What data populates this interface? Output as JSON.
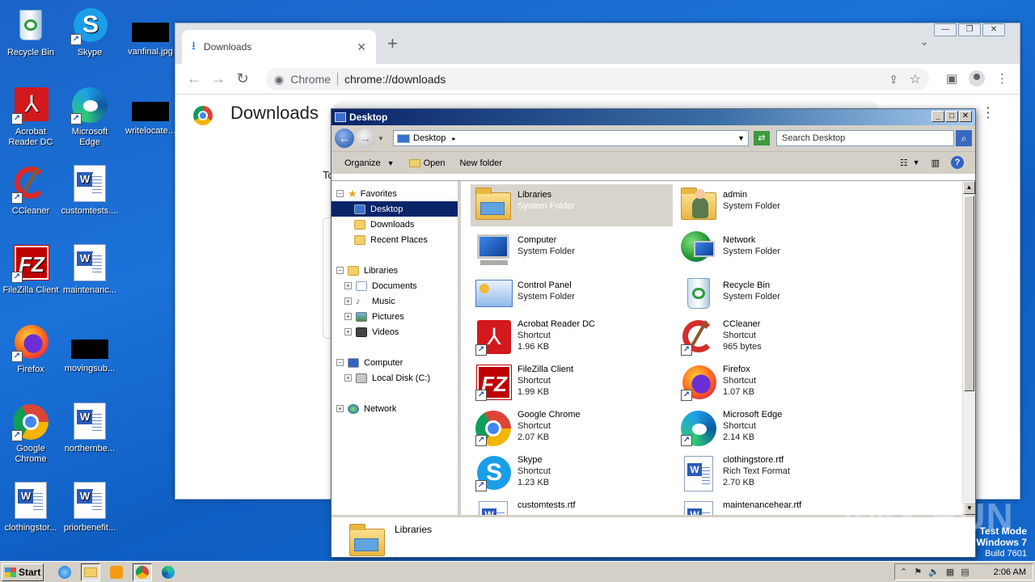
{
  "desktop": {
    "icons": [
      {
        "label": "Recycle Bin",
        "icon": "recycle-bin-icon"
      },
      {
        "label": "Skype",
        "icon": "skype-icon"
      },
      {
        "label": "vanfinal.jpg",
        "icon": "image-thumbnail-icon"
      },
      {
        "label": "Acrobat Reader DC",
        "icon": "acrobat-icon"
      },
      {
        "label": "Microsoft Edge",
        "icon": "edge-icon"
      },
      {
        "label": "writelocate...",
        "icon": "image-thumbnail-icon"
      },
      {
        "label": "CCleaner",
        "icon": "ccleaner-icon"
      },
      {
        "label": "customtests....",
        "icon": "word-doc-icon"
      },
      {
        "label": "FileZilla Client",
        "icon": "filezilla-icon"
      },
      {
        "label": "maintenanc...",
        "icon": "word-doc-icon"
      },
      {
        "label": "Firefox",
        "icon": "firefox-icon"
      },
      {
        "label": "movingsub...",
        "icon": "image-thumbnail-icon"
      },
      {
        "label": "Google Chrome",
        "icon": "chrome-icon"
      },
      {
        "label": "northernbe...",
        "icon": "word-doc-icon"
      },
      {
        "label": "clothingstor...",
        "icon": "word-doc-icon"
      },
      {
        "label": "priorbenefit...",
        "icon": "word-doc-icon"
      }
    ]
  },
  "chrome": {
    "tab_title": "Downloads",
    "omnibox_site": "Chrome",
    "omnibox_url": "chrome://downloads",
    "page_title": "Downloads",
    "today_label": "To"
  },
  "explorer": {
    "window_title": "Desktop",
    "address_path": "Desktop",
    "search_placeholder": "Search Desktop",
    "commands": {
      "organize": "Organize",
      "open": "Open",
      "new_folder": "New folder"
    },
    "nav": {
      "favorites": "Favorites",
      "desktop": "Desktop",
      "downloads": "Downloads",
      "recent_places": "Recent Places",
      "libraries": "Libraries",
      "documents": "Documents",
      "music": "Music",
      "pictures": "Pictures",
      "videos": "Videos",
      "computer": "Computer",
      "local_disk": "Local Disk (C:)",
      "network": "Network"
    },
    "items": [
      {
        "name": "Libraries",
        "type": "System Folder",
        "size": ""
      },
      {
        "name": "admin",
        "type": "System Folder",
        "size": ""
      },
      {
        "name": "Computer",
        "type": "System Folder",
        "size": ""
      },
      {
        "name": "Network",
        "type": "System Folder",
        "size": ""
      },
      {
        "name": "Control Panel",
        "type": "System Folder",
        "size": ""
      },
      {
        "name": "Recycle Bin",
        "type": "System Folder",
        "size": ""
      },
      {
        "name": "Acrobat Reader DC",
        "type": "Shortcut",
        "size": "1.96 KB"
      },
      {
        "name": "CCleaner",
        "type": "Shortcut",
        "size": "965 bytes"
      },
      {
        "name": "FileZilla Client",
        "type": "Shortcut",
        "size": "1.99 KB"
      },
      {
        "name": "Firefox",
        "type": "Shortcut",
        "size": "1.07 KB"
      },
      {
        "name": "Google Chrome",
        "type": "Shortcut",
        "size": "2.07 KB"
      },
      {
        "name": "Microsoft Edge",
        "type": "Shortcut",
        "size": "2.14 KB"
      },
      {
        "name": "Skype",
        "type": "Shortcut",
        "size": "1.23 KB"
      },
      {
        "name": "clothingstore.rtf",
        "type": "Rich Text Format",
        "size": "2.70 KB"
      },
      {
        "name": "customtests.rtf",
        "type": "",
        "size": ""
      },
      {
        "name": "maintenancehear.rtf",
        "type": "",
        "size": ""
      }
    ],
    "details_name": "Libraries"
  },
  "taskbar": {
    "start_label": "Start",
    "clock": "2:06 AM"
  },
  "watermark": {
    "line1": "Test Mode",
    "line2": "Windows 7",
    "line3": "Build 7601",
    "brand": "ANY RUN"
  }
}
